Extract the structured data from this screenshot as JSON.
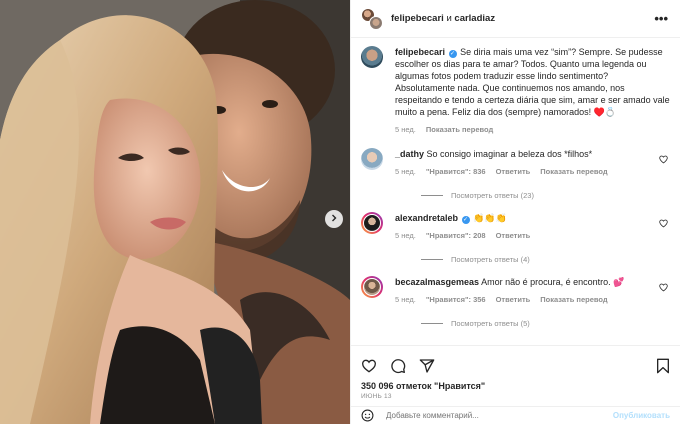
{
  "header": {
    "user1": "felipebecari",
    "conjunction": "и",
    "user2": "carladiaz",
    "more_icon": "more-horizontal-icon"
  },
  "caption": {
    "username": "felipebecari",
    "text": "Se diria mais uma vez “sim”? Sempre. Se pudesse escolher os dias para te amar? Todos. Quanto uma legenda ou algumas fotos podem traduzir esse lindo sentimento? Absolutamente nada. Que continuemos nos amando, nos respeitando e tendo a certeza diária que sim, amar e ser amado vale muito a pena. Feliz dia dos (sempre) namorados! ♥️💍",
    "time": "5 нед.",
    "translate": "Показать перевод"
  },
  "comments": [
    {
      "username": "_dathy",
      "verified": false,
      "text": "So consigo imaginar a beleza dos *filhos*",
      "time": "5 нед.",
      "likes": "\"Нравится\": 836",
      "reply": "Ответить",
      "translate": "Показать перевод",
      "replies": "Посмотреть ответы (23)"
    },
    {
      "username": "alexandretaleb",
      "verified": true,
      "text": "👏👏👏",
      "time": "5 нед.",
      "likes": "\"Нравится\": 208",
      "reply": "Ответить",
      "replies": "Посмотреть ответы (4)"
    },
    {
      "username": "becazalmasgemeas",
      "verified": false,
      "text": "Amor não é procura, é encontro. 💕",
      "time": "5 нед.",
      "likes": "\"Нравится\": 356",
      "reply": "Ответить",
      "translate": "Показать перевод",
      "replies": "Посмотреть ответы (5)"
    }
  ],
  "footer": {
    "likes": "350 096 отметок \"Нравится\"",
    "date": "ИЮНЬ 13",
    "comment_placeholder": "Добавьте комментарий...",
    "post_button": "Опубликовать"
  },
  "icons": [
    "heart-icon",
    "comment-icon",
    "share-icon",
    "bookmark-icon",
    "emoji-icon",
    "chevron-right-icon"
  ],
  "colors": {
    "link_blue": "#3897f0",
    "muted": "#8e8e8e",
    "post_disabled": "#b2dffc"
  }
}
